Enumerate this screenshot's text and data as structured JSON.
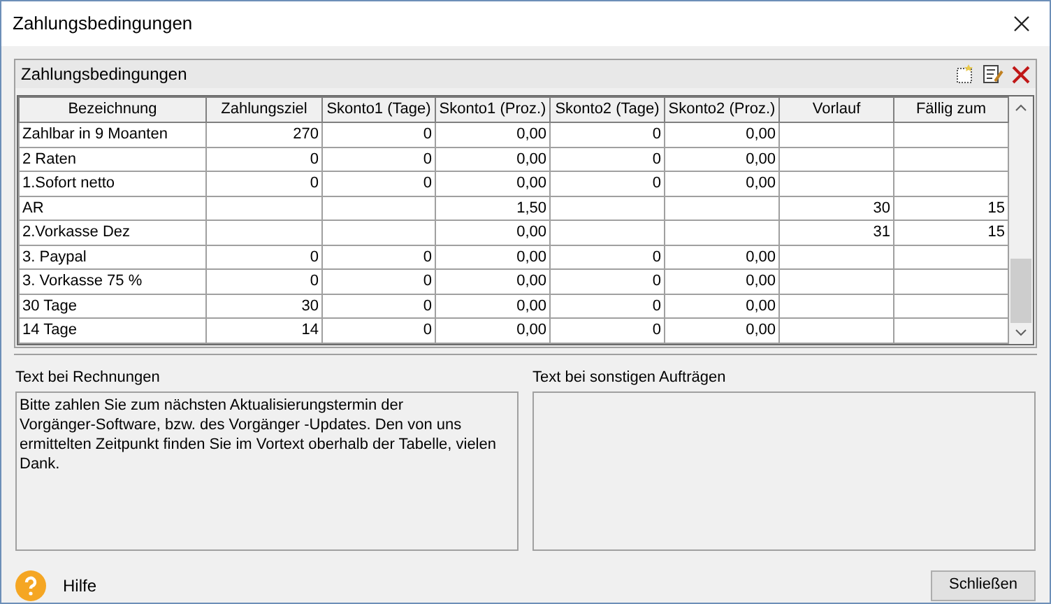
{
  "window": {
    "title": "Zahlungsbedingungen"
  },
  "panel": {
    "title": "Zahlungsbedingungen"
  },
  "table": {
    "columns": [
      "Bezeichnung",
      "Zahlungsziel",
      "Skonto1 (Tage)",
      "Skonto1 (Proz.)",
      "Skonto2 (Tage)",
      "Skonto2 (Proz.)",
      "Vorlauf",
      "Fällig zum"
    ],
    "rows": [
      {
        "cells": [
          "Zahlbar in 9 Moanten",
          "270",
          "0",
          "0,00",
          "0",
          "0,00",
          null,
          null
        ]
      },
      {
        "cells": [
          "2 Raten",
          "0",
          "0",
          "0,00",
          "0",
          "0,00",
          null,
          null
        ]
      },
      {
        "cells": [
          "1.Sofort netto",
          "0",
          "0",
          "0,00",
          "0",
          "0,00",
          null,
          null
        ]
      },
      {
        "cells": [
          "AR",
          null,
          null,
          "1,50",
          null,
          null,
          "30",
          "15"
        ]
      },
      {
        "cells": [
          "2.Vorkasse Dez",
          null,
          null,
          "0,00",
          null,
          null,
          "31",
          "15"
        ]
      },
      {
        "cells": [
          "3. Paypal",
          "0",
          "0",
          "0,00",
          "0",
          "0,00",
          null,
          null
        ]
      },
      {
        "cells": [
          "3. Vorkasse 75 %",
          "0",
          "0",
          "0,00",
          "0",
          "0,00",
          null,
          null
        ]
      },
      {
        "cells": [
          "30 Tage",
          "30",
          "0",
          "0,00",
          "0",
          "0,00",
          null,
          null
        ]
      },
      {
        "cells": [
          "14 Tage",
          "14",
          "0",
          "0,00",
          "0",
          "0,00",
          null,
          null
        ]
      }
    ]
  },
  "invoice_text": {
    "label": "Text bei Rechnungen",
    "value": "Bitte zahlen Sie zum nächsten Aktualisierungstermin der\nVorgänger-Software, bzw. des Vorgänger -Updates. Den von uns ermittelten Zeitpunkt finden Sie im Vortext oberhalb der Tabelle, vielen Dank."
  },
  "other_text": {
    "label": "Text bei sonstigen Aufträgen"
  },
  "help": {
    "label": "Hilfe"
  },
  "buttons": [
    "Schließen"
  ]
}
